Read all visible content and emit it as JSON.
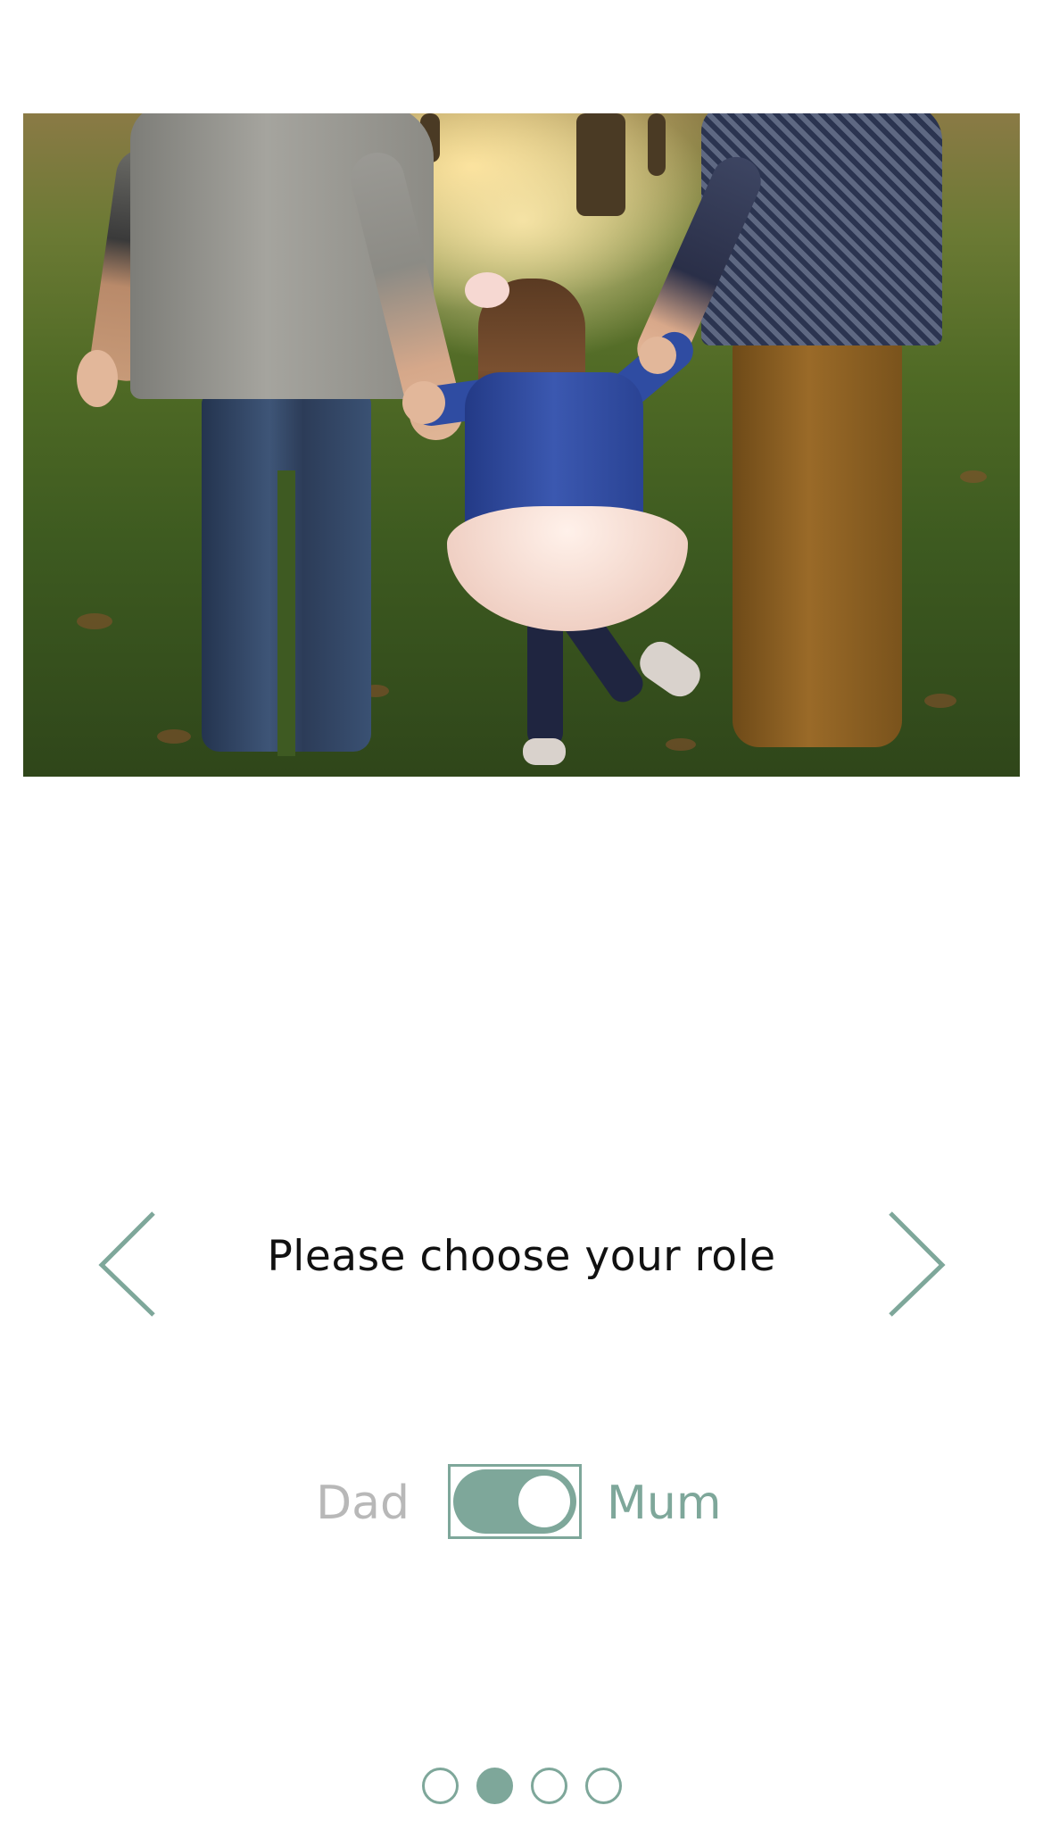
{
  "hero": {
    "image": "family-walking-holding-hands-photo"
  },
  "prompt": {
    "text": "Please choose your role"
  },
  "nav": {
    "prev_icon": "chevron-left-icon",
    "next_icon": "chevron-right-icon"
  },
  "role_toggle": {
    "left_label": "Dad",
    "right_label": "Mum",
    "selected": "Mum",
    "on": true
  },
  "pager": {
    "count": 4,
    "active_index": 1
  },
  "colors": {
    "accent": "#7ea79a",
    "inactive_text": "#b8b8b8",
    "prompt_text": "#111111",
    "background": "#ffffff"
  }
}
